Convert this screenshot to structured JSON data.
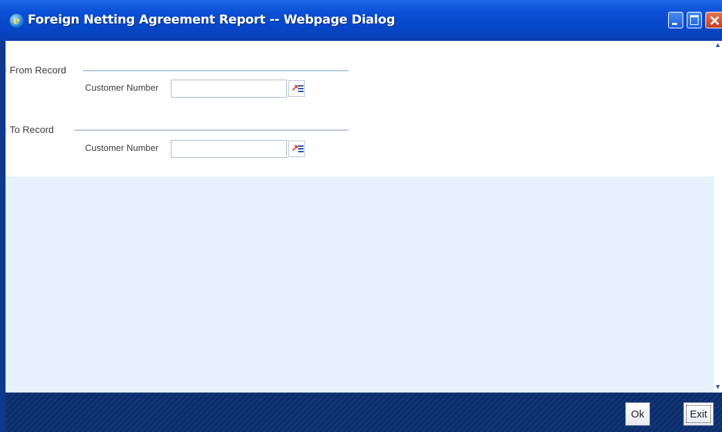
{
  "window": {
    "title": "Foreign Netting Agreement Report -- Webpage Dialog",
    "icon": "ie-browser-icon"
  },
  "sections": [
    {
      "title": "From Record",
      "field_label": "Customer Number",
      "value": ""
    },
    {
      "title": "To Record",
      "field_label": "Customer Number",
      "value": ""
    }
  ],
  "footer": {
    "ok_label": "Ok",
    "exit_label": "Exit"
  }
}
